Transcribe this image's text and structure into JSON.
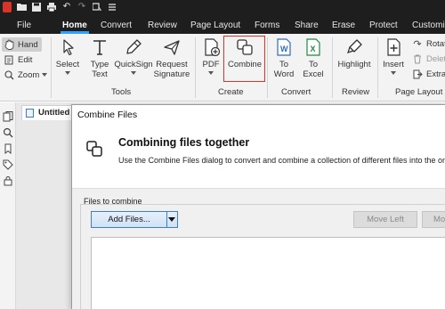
{
  "quick_access": {
    "icons": [
      "app-logo-icon",
      "open-folder-icon",
      "save-icon",
      "print-icon",
      "undo-icon",
      "redo-icon",
      "select-tool-icon",
      "customize-icon"
    ],
    "undo_glyph": "↶",
    "redo_glyph": "↷"
  },
  "menu_tabs": [
    {
      "label": "File"
    },
    {
      "label": "Home",
      "active": true
    },
    {
      "label": "Convert"
    },
    {
      "label": "Review"
    },
    {
      "label": "Page Layout"
    },
    {
      "label": "Forms"
    },
    {
      "label": "Share"
    },
    {
      "label": "Erase"
    },
    {
      "label": "Protect"
    },
    {
      "label": "Customiz"
    }
  ],
  "ribbon": {
    "small_tools": {
      "hand": "Hand",
      "edit": "Edit",
      "zoom": "Zoom"
    },
    "tools": {
      "label": "Tools",
      "buttons": [
        {
          "line1": "Select",
          "line2": ""
        },
        {
          "line1": "Type",
          "line2": "Text"
        },
        {
          "line1": "QuickSign",
          "line2": ""
        },
        {
          "line1": "Request",
          "line2": "Signature"
        }
      ]
    },
    "create": {
      "label": "Create",
      "pdf": "PDF",
      "combine": "Combine"
    },
    "convert": {
      "label": "Convert",
      "to_word": {
        "line1": "To",
        "line2": "Word"
      },
      "to_excel": {
        "line1": "To",
        "line2": "Excel"
      }
    },
    "review": {
      "label": "Review",
      "highlight": "Highlight"
    },
    "page_layout": {
      "label": "Page Layout",
      "insert": "Insert",
      "rotate": "Rotat",
      "delete": "Delet",
      "extract": "Extrac"
    }
  },
  "document_tab": {
    "title": "Untitled"
  },
  "dialog": {
    "title": "Combine Files",
    "heading": "Combining files together",
    "description": "Use the Combine Files dialog to convert and combine a collection of different files into the one p",
    "files_label": "Files to combine",
    "add_files": "Add Files...",
    "move_left": "Move Left",
    "move_right": "Mov"
  },
  "colors": {
    "title_bar": "#1e1e1e",
    "active_tab_underline": "#2ea2ff",
    "highlight_box": "#d9342b",
    "word_blue": "#2b6cc4",
    "excel_green": "#1e8a3e",
    "add_files_border": "#3c7fd1"
  }
}
